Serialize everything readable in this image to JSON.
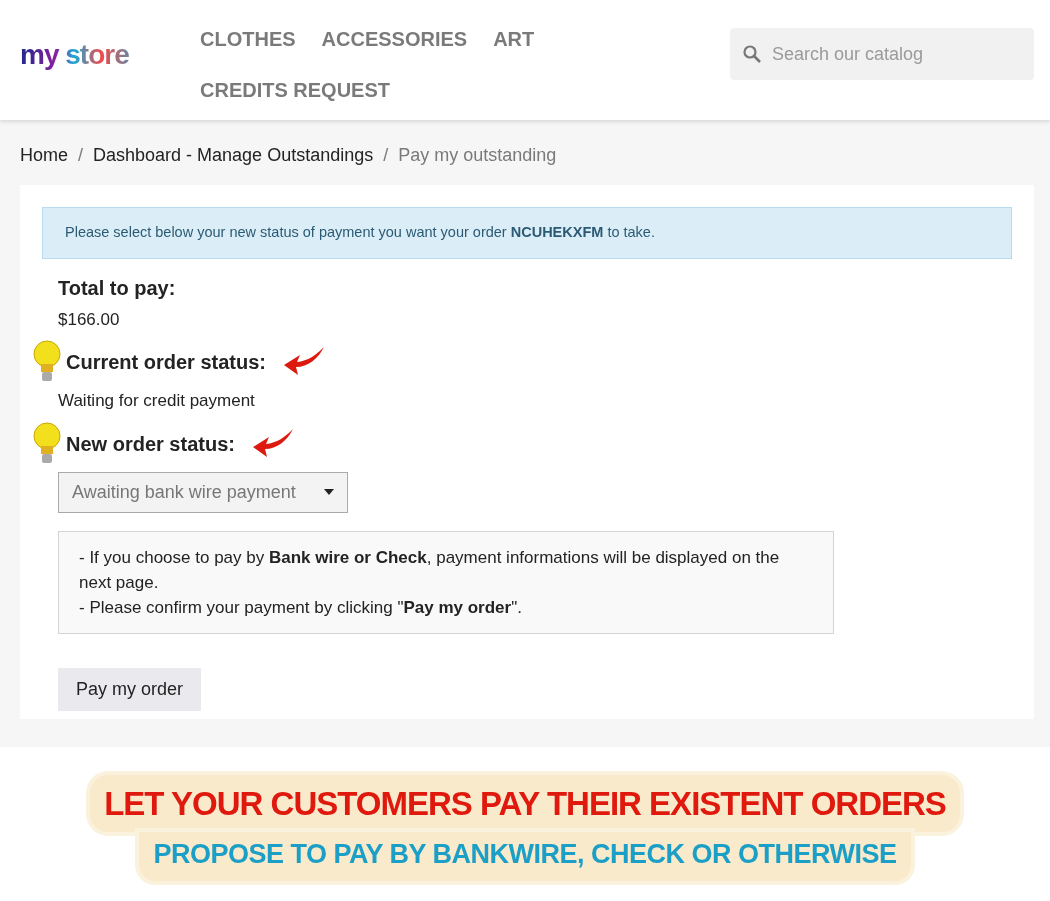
{
  "logo": "my store",
  "nav": [
    {
      "label": "CLOTHES"
    },
    {
      "label": "ACCESSORIES"
    },
    {
      "label": "ART"
    },
    {
      "label": "CREDITS REQUEST"
    }
  ],
  "search": {
    "placeholder": "Search our catalog"
  },
  "breadcrumb_separator": "/",
  "breadcrumb": [
    {
      "label": "Home",
      "current": false
    },
    {
      "label": "Dashboard - Manage Outstandings",
      "current": false
    },
    {
      "label": "Pay my outstanding",
      "current": true
    }
  ],
  "alert": "Please select below your new status of payment you want your order **NCUHEKXFM** to take.",
  "total": {
    "label": "Total to pay:",
    "value": "$166.00"
  },
  "current_status": {
    "label": "Current order status:",
    "value": "Waiting for credit payment"
  },
  "new_status": {
    "label": "New order status:",
    "value": "Awaiting bank wire payment"
  },
  "info_lines": [
    "- If you choose to pay by **Bank wire or Check**, payment informations will be displayed on the next page.",
    "- Please confirm your payment by clicking \"**Pay my order**\"."
  ],
  "button": "Pay my order",
  "banner": {
    "headline": "LET YOUR CUSTOMERS PAY THEIR EXISTENT ORDERS",
    "subline": "PROPOSE TO PAY BY BANKWIRE, CHECK OR OTHERWISE"
  }
}
